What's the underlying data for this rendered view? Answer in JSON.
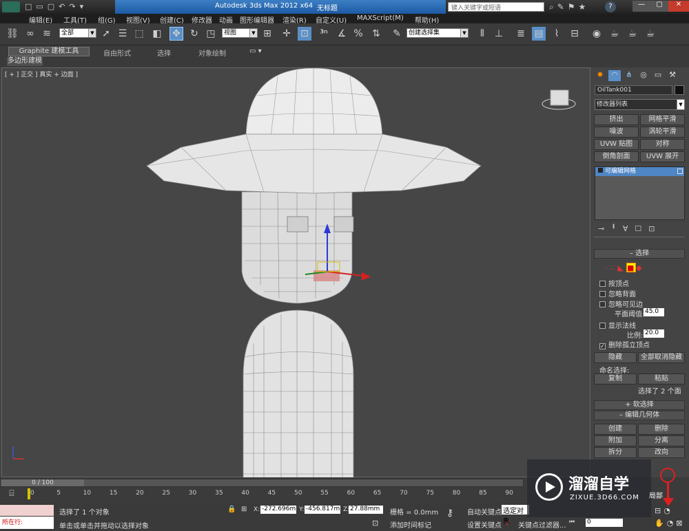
{
  "title": {
    "app": "Autodesk 3ds Max  2012 x64",
    "file": "无标题",
    "search_placeholder": "键入关键字或短语"
  },
  "menu": [
    "编辑(E)",
    "工具(T)",
    "组(G)",
    "视图(V)",
    "创建(C)",
    "修改器",
    "动画",
    "图形编辑器",
    "渲染(R)",
    "自定义(U)",
    "MAXScript(M)",
    "帮助(H)"
  ],
  "toolbar": {
    "selection_filter": "全部",
    "reference_coord": "视图",
    "named_selection": "创建选择集"
  },
  "ribbon": {
    "tabs": [
      "Graphite 建模工具",
      "自由形式",
      "选择",
      "对象绘制"
    ],
    "subtab": "多边形建模"
  },
  "viewport": {
    "label": "[ + ] 正交 ] 真实 + 边面 ]"
  },
  "cmdpanel": {
    "object_name": "OilTank001",
    "modifier_list": "修改器列表",
    "modifier_buttons": [
      "挤出",
      "网格平滑",
      "噪波",
      "涡轮平滑",
      "UVW 贴图",
      "对称",
      "倒角剖面",
      "UVW 展开"
    ],
    "stack_item": "可编辑网格",
    "selection": {
      "title": "选择",
      "by_vertex": "按顶点",
      "ignore_backfacing": "忽略背面",
      "ignore_visible": "忽略可见边",
      "planar_thresh_label": "平面阈值:",
      "planar_thresh": "45.0",
      "show_normals": "显示法线",
      "scale_label": "比例:",
      "scale": "20.0",
      "delete_isolated": "删除孤立顶点",
      "hide": "隐藏",
      "unhide_all": "全部取消隐藏",
      "named_sel": "命名选择:",
      "copy": "复制",
      "paste": "粘贴",
      "status": "选择了 2 个面"
    },
    "soft_selection": "软选择",
    "edit_geometry": {
      "title": "编辑几何体",
      "buttons": [
        "创建",
        "删除",
        "附加",
        "分离",
        "拆分",
        "改向"
      ]
    }
  },
  "timeline": {
    "frame": "0 / 100",
    "ticks": [
      "0",
      "5",
      "10",
      "15",
      "20",
      "25",
      "30",
      "35",
      "40",
      "45",
      "50",
      "55",
      "60",
      "65",
      "70",
      "75",
      "80",
      "85",
      "90"
    ]
  },
  "status": {
    "running": "所在行:",
    "message1": "选择了 1 个对象",
    "message2": "单击或单击并拖动以选择对象",
    "x_label": "X:",
    "x": "-272.696m",
    "y_label": "Y:",
    "y": "-456.817m",
    "z_label": "Z:",
    "z": "27.88mm",
    "grid": "栅格 = 0.0mm",
    "auto_key": "自动关键点",
    "set_key": "设置关键点",
    "selected": "选定对象",
    "add_time_tag": "添加时间标记",
    "key_filters": "关键点过滤器...",
    "frame": "0",
    "local": "局部"
  },
  "watermark": {
    "name": "溜溜自学",
    "url": "ZIXUE.3D66.COM"
  }
}
